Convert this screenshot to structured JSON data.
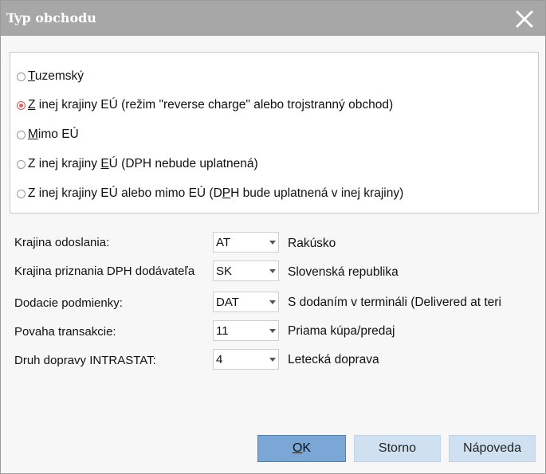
{
  "dialog": {
    "title": "Typ obchodu",
    "close_icon": "close-icon"
  },
  "radio_options": [
    {
      "pre": "",
      "u": "T",
      "post": "uzemský",
      "checked": false
    },
    {
      "pre": "",
      "u": "Z",
      "post": " inej krajiny EÚ (režim \"reverse charge\" alebo trojstranný obchod)",
      "checked": true
    },
    {
      "pre": "",
      "u": "M",
      "post": "imo EÚ",
      "checked": false
    },
    {
      "pre": "Z inej krajiny ",
      "u": "E",
      "post": "Ú (DPH nebude uplatnená)",
      "checked": false
    },
    {
      "pre": "Z inej krajiny EÚ alebo mimo EÚ (D",
      "u": "P",
      "post": "H bude uplatnená v inej krajiny)",
      "checked": false
    }
  ],
  "fields": [
    {
      "label": "Krajina odoslania:",
      "value": "AT",
      "description": "Rakúsko"
    },
    {
      "label": "Krajina priznania DPH dodávateľa",
      "value": "SK",
      "description": "Slovenská republika"
    },
    {
      "label": "Dodacie podmienky:",
      "value": "DAT",
      "description": "S dodaním v termináli (Delivered at teri"
    },
    {
      "label": "Povaha transakcie:",
      "value": "11",
      "description": "Priama kúpa/predaj"
    },
    {
      "label": "Druh dopravy INTRASTAT:",
      "value": "4",
      "description": "Letecká doprava"
    }
  ],
  "buttons": {
    "ok_u": "O",
    "ok_rest": "K",
    "storno": "Storno",
    "napoveda": "Nápoveda"
  },
  "colors": {
    "titlebar": "#a7a7a7",
    "primary_button": "#7aa7d6",
    "secondary_button": "#cfe0f0",
    "radio_selected": "#e0625e"
  }
}
